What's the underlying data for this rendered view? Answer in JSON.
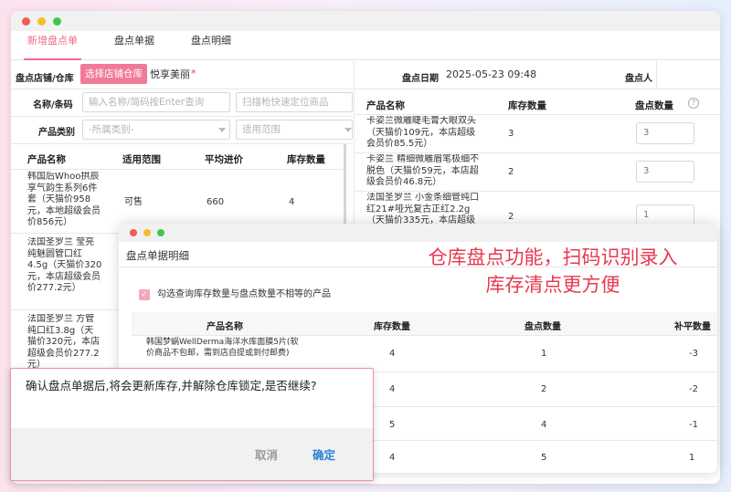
{
  "tabs": [
    "新增盘点单",
    "盘点单据",
    "盘点明细"
  ],
  "form": {
    "store_label": "盘点店铺/仓库",
    "select_store_btn": "选择店铺仓库",
    "store_value": "悦享美丽",
    "required_mark": "*",
    "name_label": "名称/条码",
    "name_placeholder": "输入名称/简码按Enter查询",
    "scan_placeholder": "扫描枪快速定位商品",
    "category_label": "产品类别",
    "category_placeholder": "-所属类别-",
    "scope_placeholder": "适用范围",
    "date_label": "盘点日期",
    "date_value": "2025-05-23 09:48",
    "person_label": "盘点人"
  },
  "left_table": {
    "headers": [
      "产品名称",
      "适用范围",
      "平均进价",
      "库存数量"
    ],
    "rows": [
      {
        "name": "韩国后Whoo拱辰享气韵生系列6件套（天猫价958元，本地超级会员价856元）",
        "scope": "可售",
        "avg": "660",
        "stock": "4"
      },
      {
        "name": "法国圣罗兰 莹亮纯魅圆管口红4.5g（天猫价320元，本店超级会员价277.2元）",
        "scope": "",
        "avg": "",
        "stock": ""
      },
      {
        "name": "法国圣罗兰 方管纯口红3.8g（天猫价320元，本店超级会员价277.2元）",
        "scope": "",
        "avg": "",
        "stock": ""
      }
    ]
  },
  "right_table": {
    "headers": [
      "产品名称",
      "库存数量",
      "盘点数量"
    ],
    "help_icon": "?",
    "rows": [
      {
        "name": "卡姿兰微雕睫毛膏大眼双头（天猫价109元，本店超级会员价85.5元）",
        "stock": "3",
        "count": "3"
      },
      {
        "name": "卡姿兰 精细微雕眉笔极细不脱色（天猫价59元，本店超级会员价46.8元）",
        "stock": "2",
        "count": "3"
      },
      {
        "name": "法国圣罗兰 小金条细管纯口红21#哑光复古正红2.2g（天猫价335元，本店超级会员价）",
        "stock": "2",
        "count": "1"
      }
    ]
  },
  "detail_window": {
    "title": "盘点单据明细",
    "checkbox_label": "勾选查询库存数量与盘点数量不相等的产品",
    "headers": [
      "产品名称",
      "库存数量",
      "盘点数量",
      "补平数量"
    ],
    "rows": [
      {
        "name": "韩国梦蜗WellDerma海洋水库面膜5片(软价商品不包邮，需到店自提或到付邮费)",
        "stock": "4",
        "count": "1",
        "diff": "-3"
      },
      {
        "name": "",
        "stock": "4",
        "count": "2",
        "diff": "-2"
      },
      {
        "name": "",
        "stock": "5",
        "count": "4",
        "diff": "-1"
      },
      {
        "name": "",
        "stock": "4",
        "count": "5",
        "diff": "1"
      }
    ]
  },
  "banner": {
    "line1": "仓库盘点功能，扫码识别录入",
    "line2": "库存清点更方便"
  },
  "confirm_dialog": {
    "message": "确认盘点单据后,将会更新库存,并解除仓库锁定,是否继续?",
    "cancel": "取消",
    "ok": "确定"
  },
  "colors": {
    "accent": "#ef6b8a",
    "banner_red": "#e8394f",
    "ok_blue": "#2b7fd6"
  }
}
